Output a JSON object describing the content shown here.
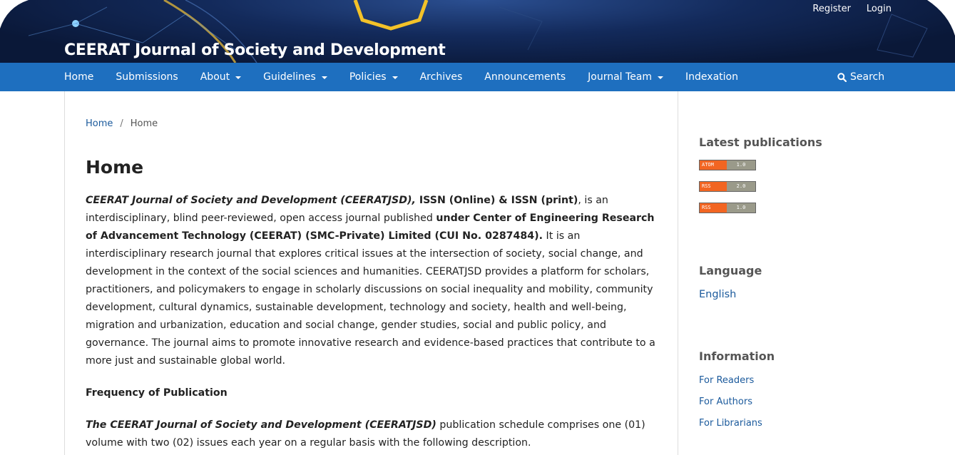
{
  "header": {
    "site_title": "CEERAT Journal of Society and Development",
    "user_nav": {
      "register": "Register",
      "login": "Login"
    }
  },
  "nav": {
    "items": [
      {
        "label": "Home",
        "dropdown": false
      },
      {
        "label": "Submissions",
        "dropdown": false
      },
      {
        "label": "About",
        "dropdown": true
      },
      {
        "label": "Guidelines",
        "dropdown": true
      },
      {
        "label": "Policies",
        "dropdown": true
      },
      {
        "label": "Archives",
        "dropdown": false
      },
      {
        "label": "Announcements",
        "dropdown": false
      },
      {
        "label": "Journal Team",
        "dropdown": true
      },
      {
        "label": "Indexation",
        "dropdown": false
      }
    ],
    "search_label": "Search",
    "search_icon": "search-icon"
  },
  "breadcrumb": {
    "home": "Home",
    "separator": "/",
    "current": "Home"
  },
  "main": {
    "title": "Home",
    "p1": {
      "journal_name": "CEERAT  Journal of Society and Development (CEERATJSD),",
      "issn": " ISSN (Online) & ISSN (print)",
      "text1": ", is an interdisciplinary, blind peer-reviewed, open access journal published ",
      "publisher": "under Center of Engineering Research of Advancement Technology (CEERAT)  (SMC-Private) Limited (CUI No. 0287484).",
      "text2": " It is an interdisciplinary research journal that explores critical issues at the intersection of society, social change, and development in the context of the social sciences and humanities. CEERATJSD provides a platform for scholars, practitioners, and policymakers to engage in scholarly discussions on social inequality and mobility, community development, cultural dynamics, sustainable development, technology and society, health and well-being, migration and urbanization, education and social change, gender studies, social and public policy, and governance. The journal aims to promote innovative research and evidence-based practices that contribute to a more just and sustainable global world."
    },
    "frequency_heading": "Frequency of Publication",
    "p2": {
      "journal_name": "The CEERAT Journal of Society and Development (CEERATJSD)",
      "text": " publication schedule comprises one (01) volume with two (02) issues each year on a regular basis with the following description."
    }
  },
  "sidebar": {
    "latest_title": "Latest publications",
    "feeds": [
      {
        "left": "ATOM",
        "right": "1.0"
      },
      {
        "left": "RSS",
        "right": "2.0"
      },
      {
        "left": "RSS",
        "right": "1.0"
      }
    ],
    "language_title": "Language",
    "language_value": "English",
    "information_title": "Information",
    "info_links": [
      "For Readers",
      "For Authors",
      "For Librarians"
    ]
  },
  "colors": {
    "nav_bg": "#1e6fbf",
    "header_bg": "#132a5b",
    "link": "#1b5a9c",
    "feed_orange": "#f26522"
  }
}
